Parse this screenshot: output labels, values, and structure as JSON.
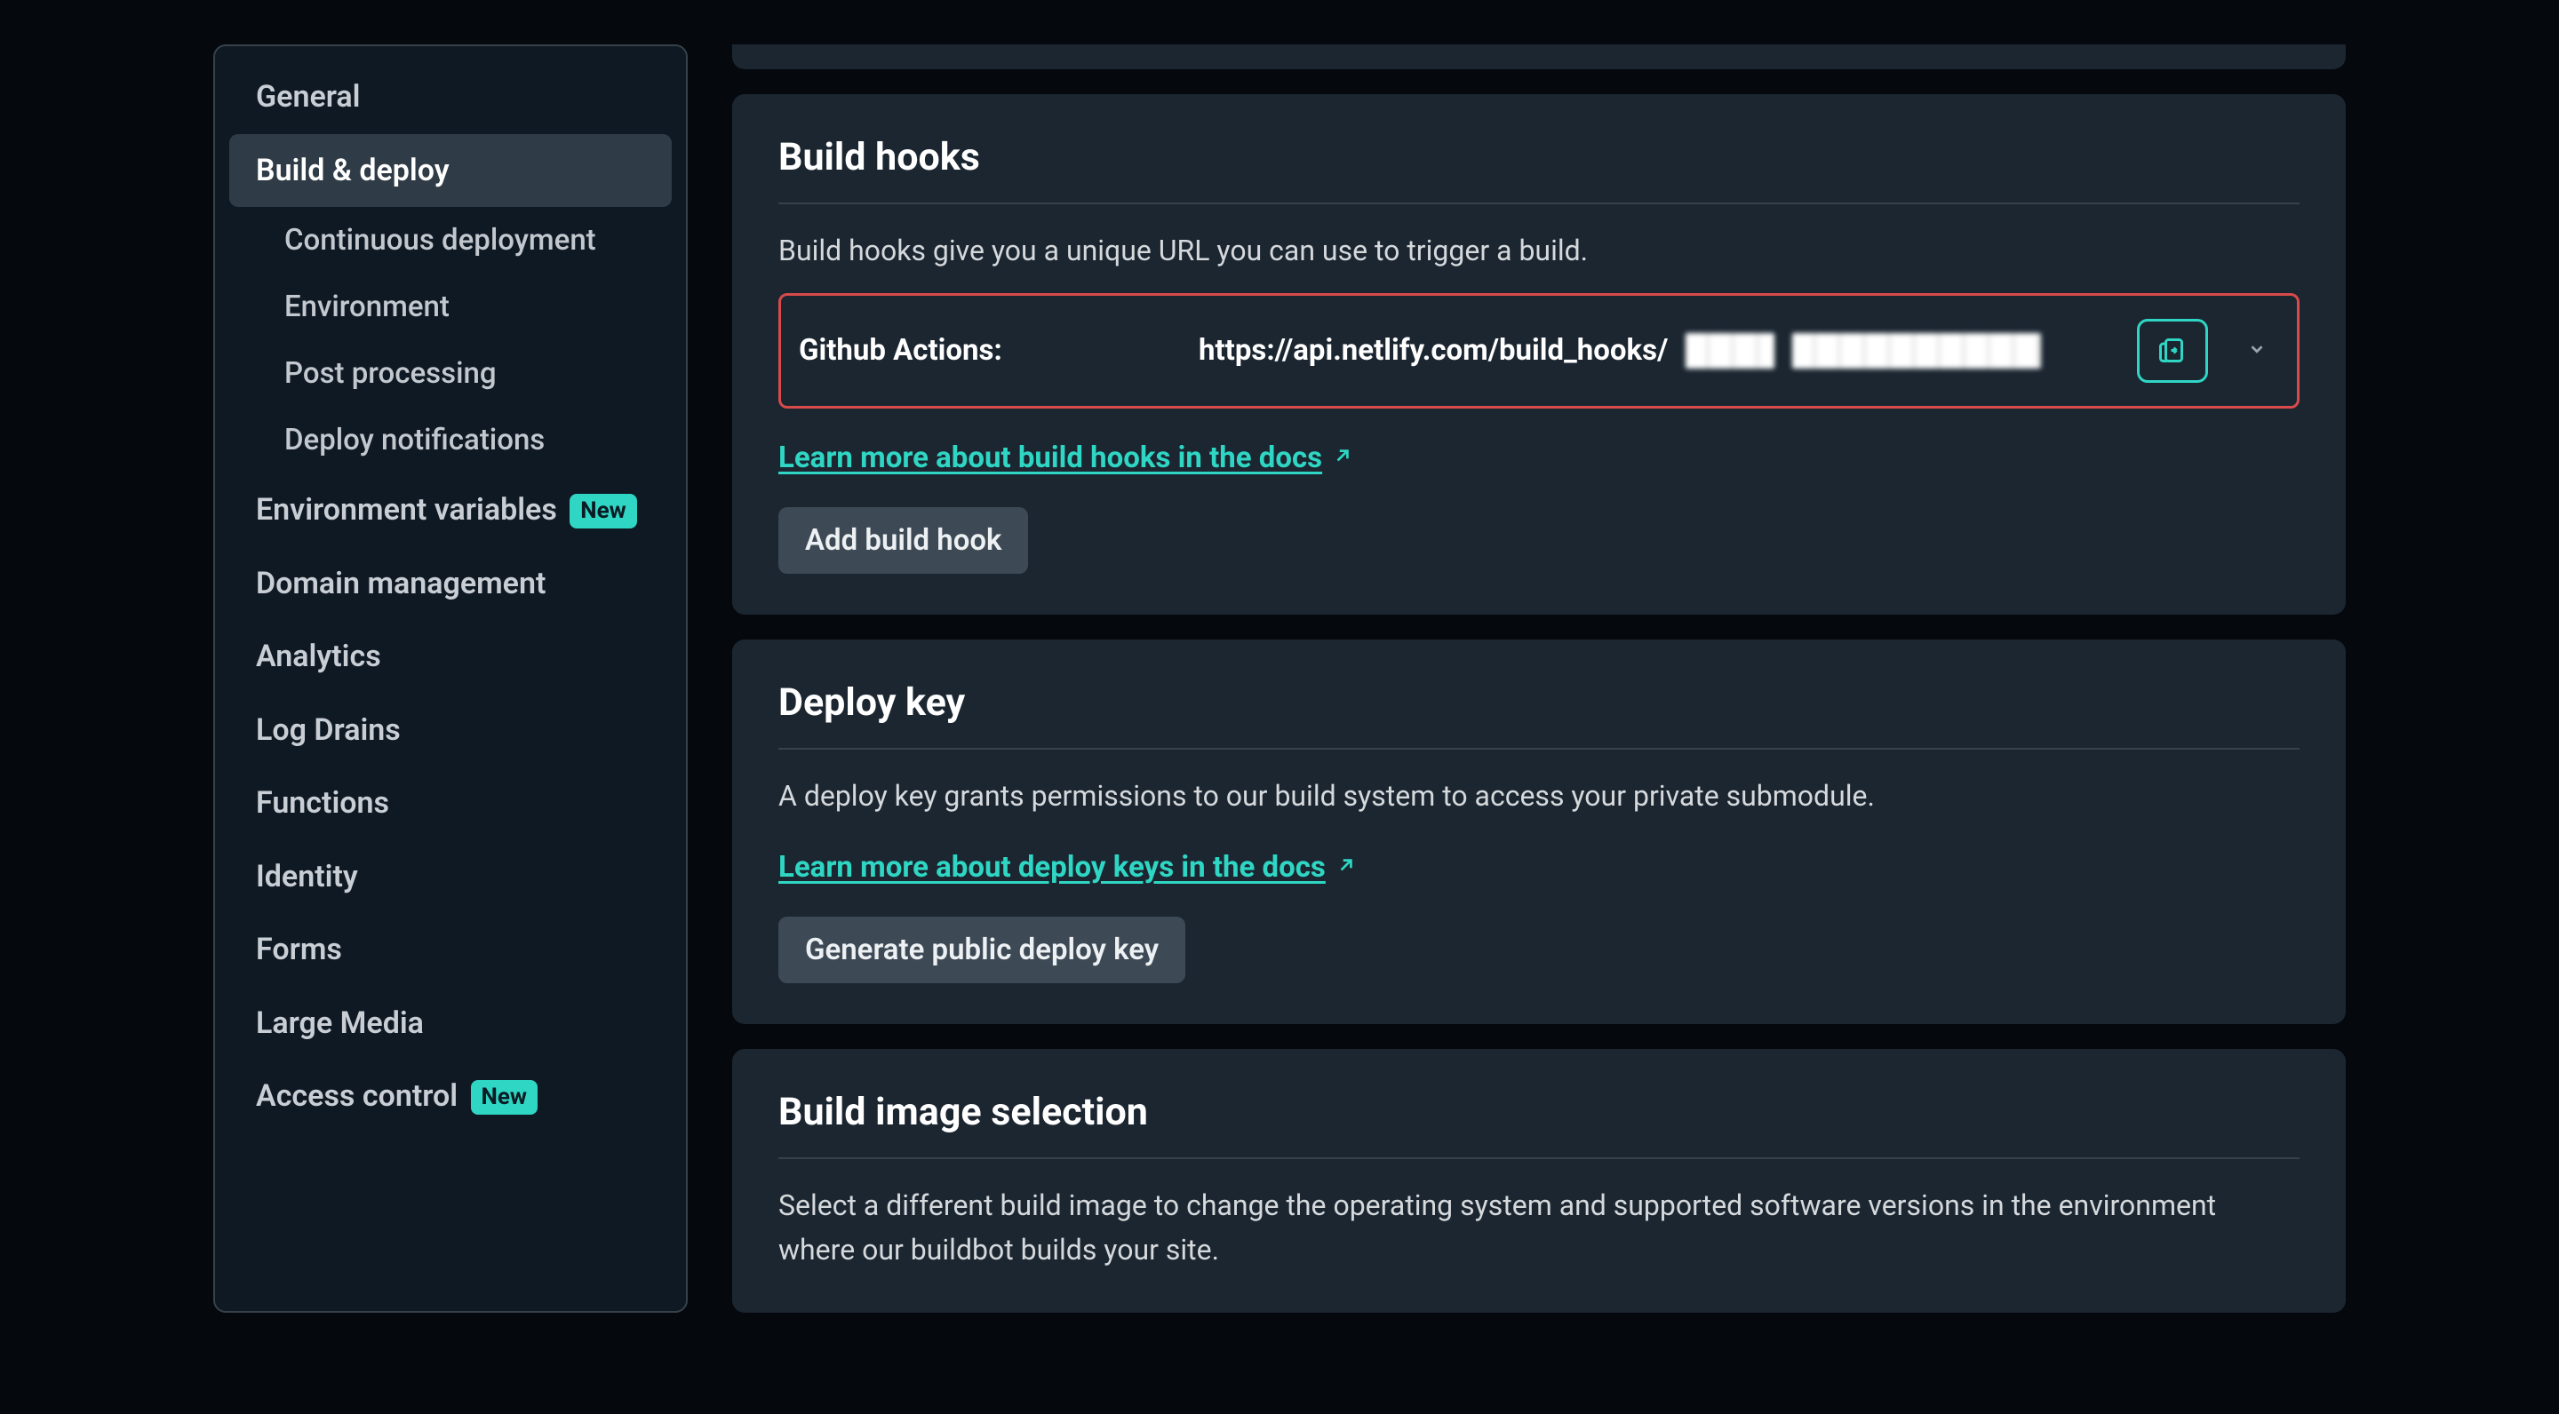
{
  "sidebar": {
    "items": [
      {
        "label": "General"
      },
      {
        "label": "Build & deploy",
        "active": true
      },
      {
        "label": "Environment variables",
        "badge": "New"
      },
      {
        "label": "Domain management"
      },
      {
        "label": "Analytics"
      },
      {
        "label": "Log Drains"
      },
      {
        "label": "Functions"
      },
      {
        "label": "Identity"
      },
      {
        "label": "Forms"
      },
      {
        "label": "Large Media"
      },
      {
        "label": "Access control",
        "badge": "New"
      }
    ],
    "subitems": [
      {
        "label": "Continuous deployment"
      },
      {
        "label": "Environment"
      },
      {
        "label": "Post processing"
      },
      {
        "label": "Deploy notifications"
      }
    ]
  },
  "build_hooks": {
    "title": "Build hooks",
    "description": "Build hooks give you a unique URL you can use to trigger a build.",
    "hook_name": "Github Actions",
    "hook_url_prefix": "https://api.netlify.com/build_hooks/",
    "learn_more": "Learn more about build hooks in the docs",
    "add_button": "Add build hook"
  },
  "deploy_key": {
    "title": "Deploy key",
    "description": "A deploy key grants permissions to our build system to access your private submodule.",
    "learn_more": "Learn more about deploy keys in the docs",
    "generate_button": "Generate public deploy key"
  },
  "build_image": {
    "title": "Build image selection",
    "description": "Select a different build image to change the operating system and supported software versions in the environment where our buildbot builds your site."
  },
  "badges": {
    "new": "New"
  }
}
